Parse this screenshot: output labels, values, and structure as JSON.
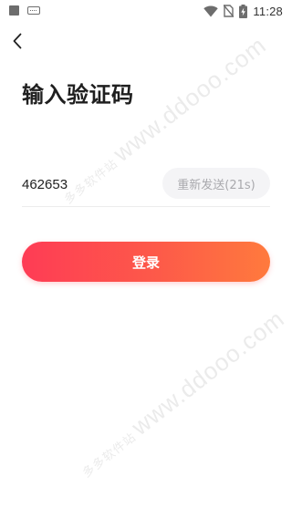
{
  "status_bar": {
    "time": "11:28",
    "icons": [
      "notification-square-icon",
      "keyboard-icon",
      "wifi-icon",
      "no-sim-icon",
      "battery-charging-icon"
    ]
  },
  "header": {
    "back_icon": "chevron-left-icon",
    "title": "输入验证码"
  },
  "verification": {
    "code_value": "462653",
    "resend_label": "重新发送(21s)"
  },
  "actions": {
    "login_label": "登录"
  },
  "watermark": {
    "name": "多多软件站",
    "domain": "www.ddooo.com"
  },
  "colors": {
    "accent_start": "#fe3c55",
    "accent_end": "#ff7a3d",
    "title": "#1f1f1f",
    "resend_bg": "#f4f4f6",
    "resend_text": "#a9a9ad"
  }
}
